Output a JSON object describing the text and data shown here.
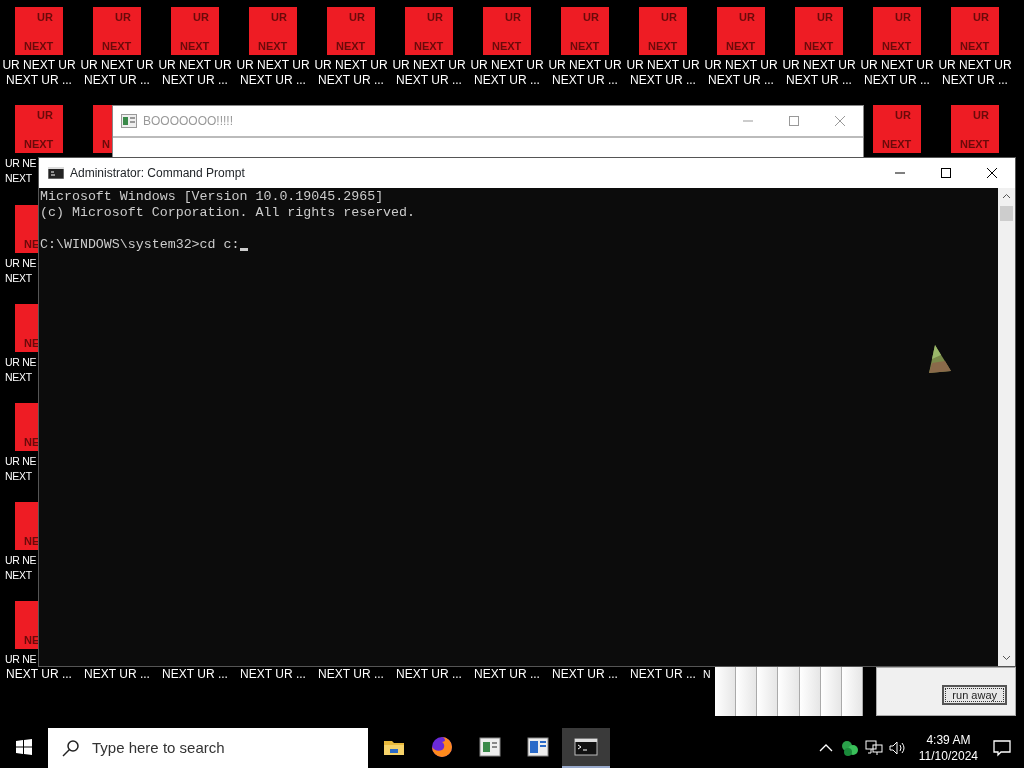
{
  "desktop_icons": [
    {
      "image_text": [
        "UR",
        "NEXT"
      ],
      "label": [
        "UR NEXT UR",
        "NEXT UR ..."
      ]
    },
    {
      "image_text": [
        "UR",
        "NEXT"
      ],
      "label": [
        "UR NEXT UR",
        "NEXT UR ..."
      ]
    },
    {
      "image_text": [
        "UR",
        "NEXT"
      ],
      "label": [
        "UR NEXT UR",
        "NEXT UR ..."
      ]
    },
    {
      "image_text": [
        "UR",
        "NEXT"
      ],
      "label": [
        "UR NEXT UR",
        "NEXT UR ..."
      ]
    },
    {
      "image_text": [
        "UR",
        "NEXT"
      ],
      "label": [
        "UR NEXT UR",
        "NEXT UR ..."
      ]
    },
    {
      "image_text": [
        "UR",
        "NEXT"
      ],
      "label": [
        "UR NEXT UR",
        "NEXT UR ..."
      ]
    },
    {
      "image_text": [
        "UR",
        "NEXT"
      ],
      "label": [
        "UR NEXT UR",
        "NEXT UR ..."
      ]
    },
    {
      "image_text": [
        "UR",
        "NEXT"
      ],
      "label": [
        "UR NEXT UR",
        "NEXT UR ..."
      ]
    },
    {
      "image_text": [
        "UR",
        "NEXT"
      ],
      "label": [
        "UR NEXT UR",
        "NEXT UR ..."
      ]
    },
    {
      "image_text": [
        "UR",
        "NEXT"
      ],
      "label": [
        "UR NEXT UR",
        "NEXT UR ..."
      ]
    },
    {
      "image_text": [
        "UR",
        "NEXT"
      ],
      "label": [
        "UR NEXT UR",
        "NEXT UR ..."
      ]
    },
    {
      "image_text": [
        "UR",
        "NEXT"
      ],
      "label": [
        "UR NEXT UR",
        "NEXT UR ..."
      ]
    },
    {
      "image_text": [
        "UR",
        "NEXT"
      ],
      "label": [
        "UR NEXT UR",
        "NEXT UR ..."
      ]
    },
    {
      "image_text": [
        "UR",
        "NEXT"
      ],
      "label": [
        "UR NE",
        "NEXT"
      ]
    },
    {
      "image_text": [
        "N"
      ]
    },
    {
      "image_text": [
        "UR",
        "NEXT"
      ]
    },
    {
      "image_text": [
        "UR",
        "NEXT"
      ]
    },
    {
      "image_text": [
        "NE"
      ],
      "label": [
        "UR NE",
        "NEXT"
      ]
    },
    {
      "image_text": [
        "NE"
      ],
      "label": [
        "UR NE",
        "NEXT"
      ]
    },
    {
      "image_text": [
        "NE"
      ],
      "label": [
        "UR NE",
        "NEXT"
      ]
    },
    {
      "image_text": [
        "NE"
      ],
      "label": [
        "UR NE",
        "NEXT"
      ]
    },
    {
      "image_text": [
        "NE"
      ],
      "label": [
        "UR NE",
        "NEXT UR ..."
      ]
    },
    {
      "label": [
        "NEXT UR ..."
      ]
    },
    {
      "label": [
        "NEXT UR ..."
      ]
    },
    {
      "label": [
        "NEXT UR ..."
      ]
    },
    {
      "label": [
        "NEXT UR ..."
      ]
    },
    {
      "label": [
        "NEXT UR ..."
      ]
    },
    {
      "label": [
        "NEXT UR ..."
      ]
    },
    {
      "label": [
        "NEXT UR ..."
      ]
    },
    {
      "label": [
        "NEXT UR ..."
      ]
    },
    {
      "label": [
        "N"
      ]
    }
  ],
  "boo_window": {
    "title": "BOOOOOOO!!!!!"
  },
  "cmd_window": {
    "title": "Administrator: Command Prompt",
    "lines": [
      "Microsoft Windows [Version 10.0.19045.2965]",
      "(c) Microsoft Corporation. All rights reserved."
    ],
    "prompt": "C:\\WINDOWS\\system32>cd c:"
  },
  "run_away_window": {
    "button": "run away"
  },
  "taskbar": {
    "search_placeholder": "Type here to search",
    "apps": [
      {
        "kind": "folder",
        "selected": false
      },
      {
        "kind": "browser",
        "selected": false
      },
      {
        "kind": "document",
        "selected": false
      },
      {
        "kind": "book",
        "selected": false
      },
      {
        "kind": "terminal",
        "selected": true
      }
    ],
    "time": "4:39 AM",
    "date": "11/10/2024"
  }
}
